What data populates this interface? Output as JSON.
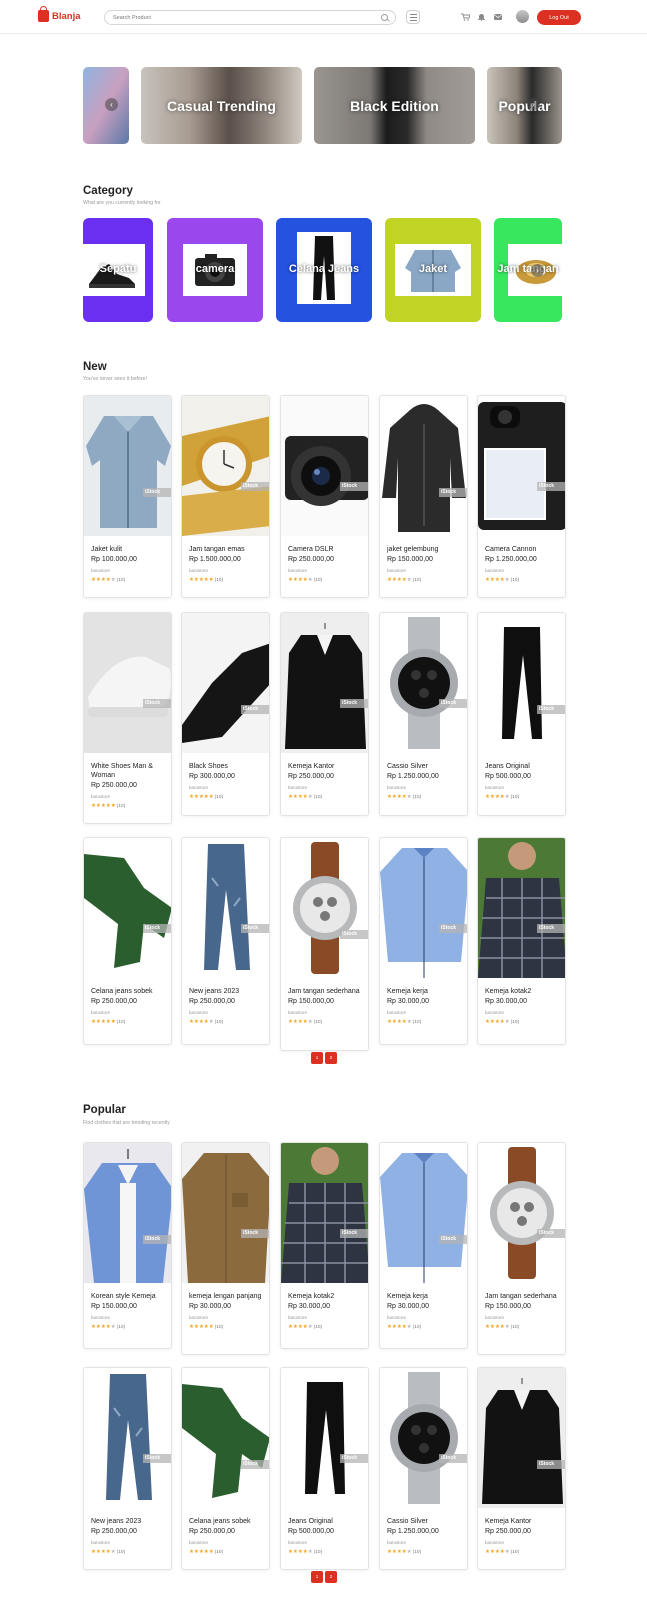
{
  "header": {
    "brand": "Blanja",
    "search_placeholder": "Search Product",
    "logout_label": "Log Out"
  },
  "banners": [
    {
      "label": ""
    },
    {
      "label": "Casual Trending"
    },
    {
      "label": "Black Edition"
    },
    {
      "label": "Popular"
    }
  ],
  "category": {
    "title": "Category",
    "subtitle": "What are you currently looking for",
    "items": [
      {
        "label": "Sepatu",
        "color": "#6a2ff0"
      },
      {
        "label": "camera",
        "color": "#9a47ee"
      },
      {
        "label": "Celana Jeans",
        "color": "#2553e0"
      },
      {
        "label": "Jaket",
        "color": "#bfd425"
      },
      {
        "label": "Jam tangan",
        "color": "#37e85f"
      }
    ]
  },
  "new": {
    "title": "New",
    "subtitle": "You've never seen it before!",
    "products": [
      {
        "name": "Jaket kulit",
        "price": "Rp 100.000,00",
        "store": "barustore",
        "count": "(10)",
        "img": "jacket",
        "stars": 4
      },
      {
        "name": "Jam tangan emas",
        "price": "Rp 1.500.000,00",
        "store": "barustore",
        "count": "(10)",
        "img": "goldwatch",
        "stars": 5
      },
      {
        "name": "Camera DSLR",
        "price": "Rp 250.000,00",
        "store": "barustore",
        "count": "(10)",
        "img": "camera",
        "stars": 4
      },
      {
        "name": "jaket gelembung",
        "price": "Rp 150.000,00",
        "store": "barustore",
        "count": "(10)",
        "img": "hoodie",
        "stars": 4
      },
      {
        "name": "Camera Cannon",
        "price": "Rp 1.250.000,00",
        "store": "barustore",
        "count": "(10)",
        "img": "camback",
        "stars": 4
      },
      {
        "name": "White Shoes Man & Woman",
        "price": "Rp 250.000,00",
        "store": "barustore",
        "count": "(10)",
        "img": "whiteshoe",
        "stars": 5
      },
      {
        "name": "Black Shoes",
        "price": "Rp 300.000,00",
        "store": "barustore",
        "count": "(10)",
        "img": "blackshoe",
        "stars": 5
      },
      {
        "name": "Kemeja Kantor",
        "price": "Rp 250.000,00",
        "store": "barustore",
        "count": "(10)",
        "img": "blazer",
        "stars": 4
      },
      {
        "name": "Cassio Silver",
        "price": "Rp 1.250.000,00",
        "store": "barustore",
        "count": "(10)",
        "img": "silverwatch",
        "stars": 4
      },
      {
        "name": "Jeans Original",
        "price": "Rp 500.000,00",
        "store": "barustore",
        "count": "(10)",
        "img": "blackjeans",
        "stars": 4
      },
      {
        "name": "Celana jeans sobek",
        "price": "Rp 250.000,00",
        "store": "barustore",
        "count": "(10)",
        "img": "greenpants",
        "stars": 5
      },
      {
        "name": "New jeans 2023",
        "price": "Rp 250.000,00",
        "store": "barustore",
        "count": "(10)",
        "img": "bluejeans",
        "stars": 4
      },
      {
        "name": "Jam tangan sederhana",
        "price": "Rp 150.000,00",
        "store": "barustore",
        "count": "(10)",
        "img": "brownwatch",
        "stars": 4
      },
      {
        "name": "Kemeja kerja",
        "price": "Rp 30.000,00",
        "store": "barustore",
        "count": "(10)",
        "img": "blueshirt",
        "stars": 4
      },
      {
        "name": "Kemeja kotak2",
        "price": "Rp 30.000,00",
        "store": "barustore",
        "count": "(10)",
        "img": "plaid",
        "stars": 4
      }
    ],
    "pages": [
      "1",
      "2"
    ]
  },
  "popular": {
    "title": "Popular",
    "subtitle": "Find clothes that are trending recently",
    "products": [
      {
        "name": "Korean style Kemeja",
        "price": "Rp 150.000,00",
        "store": "barustore",
        "count": "(10)",
        "img": "korean",
        "stars": 4
      },
      {
        "name": "kemeja lengan panjang",
        "price": "Rp 30.000,00",
        "store": "barustore",
        "count": "(10)",
        "img": "tanshirt",
        "stars": 5
      },
      {
        "name": "Kemeja kotak2",
        "price": "Rp 30.000,00",
        "store": "barustore",
        "count": "(10)",
        "img": "plaid",
        "stars": 4
      },
      {
        "name": "Kemeja kerja",
        "price": "Rp 30.000,00",
        "store": "barustore",
        "count": "(10)",
        "img": "blueshirt",
        "stars": 4
      },
      {
        "name": "Jam tangan sederhana",
        "price": "Rp 150.000,00",
        "store": "barustore",
        "count": "(10)",
        "img": "brownwatch",
        "stars": 4
      },
      {
        "name": "New jeans 2023",
        "price": "Rp 250.000,00",
        "store": "barustore",
        "count": "(10)",
        "img": "bluejeans",
        "stars": 4
      },
      {
        "name": "Celana jeans sobek",
        "price": "Rp 250.000,00",
        "store": "barustore",
        "count": "(10)",
        "img": "greenpants",
        "stars": 5
      },
      {
        "name": "Jeans Original",
        "price": "Rp 500.000,00",
        "store": "barustore",
        "count": "(10)",
        "img": "blackjeans",
        "stars": 4
      },
      {
        "name": "Cassio Silver",
        "price": "Rp 1.250.000,00",
        "store": "barustore",
        "count": "(10)",
        "img": "silverwatch",
        "stars": 4
      },
      {
        "name": "Kemeja Kantor",
        "price": "Rp 250.000,00",
        "store": "barustore",
        "count": "(10)",
        "img": "blazer",
        "stars": 4
      }
    ],
    "pages": [
      "1",
      "2"
    ]
  },
  "watermark": "iStock",
  "colors": {
    "accent": "#db3022",
    "star": "#f5a623"
  }
}
